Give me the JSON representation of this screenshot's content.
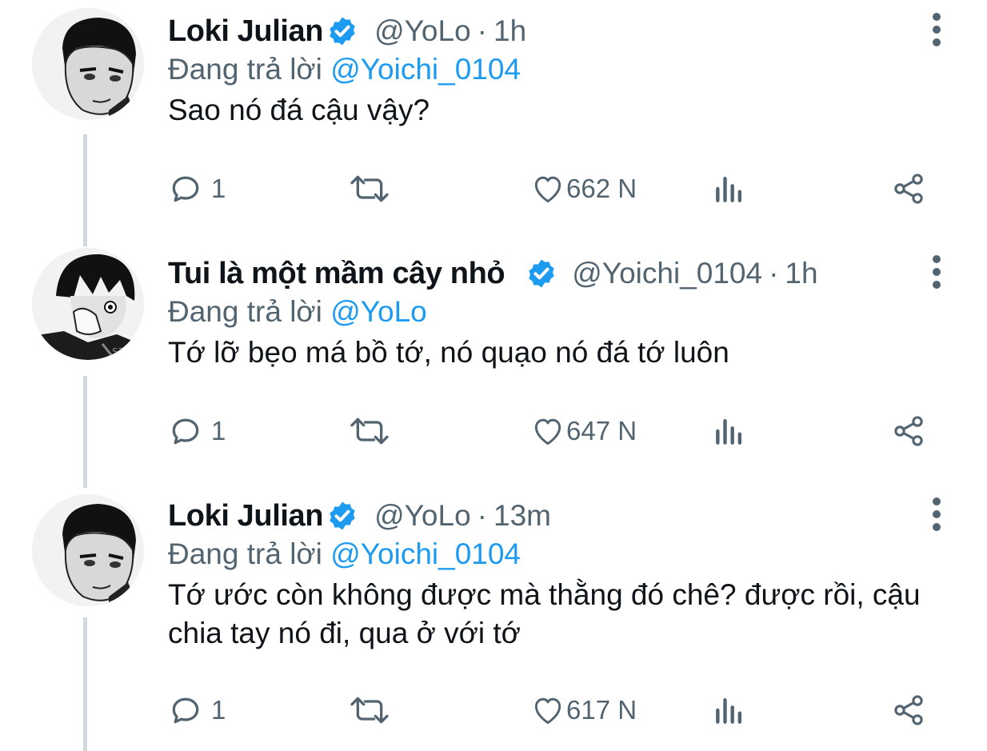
{
  "tweets": [
    {
      "display_name": "Loki Julian",
      "handle": "@YoLo",
      "time": "1h",
      "reply_prefix": "Đang trả lời",
      "reply_to": "@Yoichi_0104",
      "text": "Sao nó đá cậu vậy?",
      "replies": "1",
      "likes": "662 N",
      "avatar_icon": "avatar-loki"
    },
    {
      "display_name": "Tui là một mầm cây nhỏ",
      "handle": "@Yoichi_0104",
      "time": "1h",
      "reply_prefix": "Đang trả lời",
      "reply_to": "@YoLo",
      "text": "Tớ lỡ bẹo má bồ tớ, nó quạo nó đá tớ luôn",
      "replies": "1",
      "likes": "647 N",
      "avatar_icon": "avatar-yoichi"
    },
    {
      "display_name": "Loki Julian",
      "handle": "@YoLo",
      "time": "13m",
      "reply_prefix": "Đang trả lời",
      "reply_to": "@Yoichi_0104",
      "text": "Tớ ước còn không được mà thằng đó chê? được rồi, cậu chia tay nó đi, qua ở với tớ",
      "replies": "1",
      "likes": "617 N",
      "avatar_icon": "avatar-loki"
    }
  ],
  "colors": {
    "accent": "#1d9bf0",
    "secondary_text": "#536471",
    "thread_line": "#cfd9de"
  },
  "icons": [
    "reply-icon",
    "retweet-icon",
    "like-icon",
    "views-icon",
    "share-icon",
    "more-icon",
    "verified-badge-icon"
  ]
}
